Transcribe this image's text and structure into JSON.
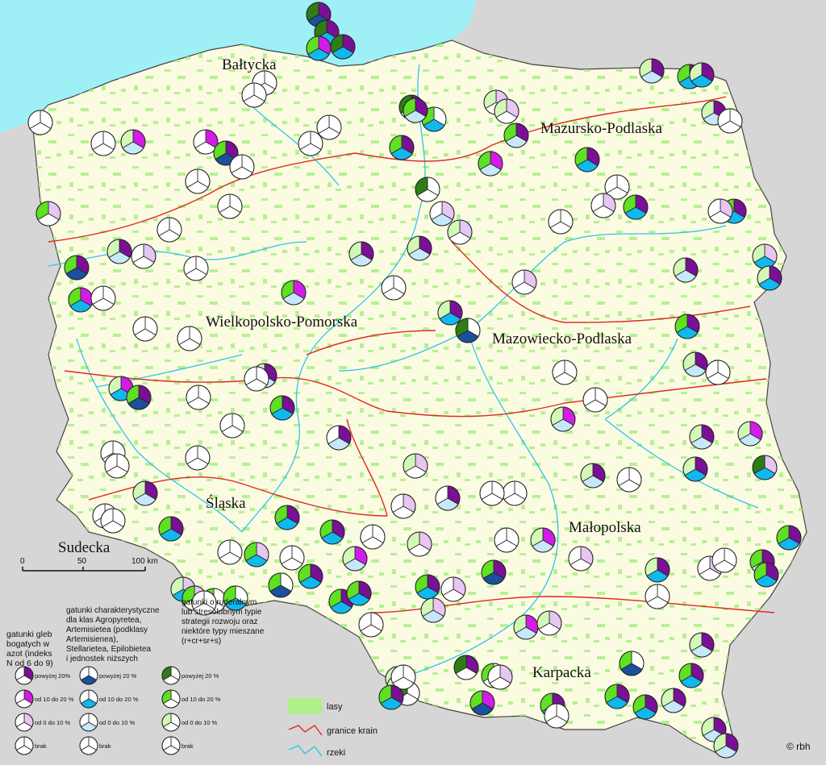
{
  "map": {
    "colors": {
      "sea": "#9ef0f6",
      "land": "#fbfbe2",
      "outside": "#d6d6d6",
      "forest": "#aef08a",
      "border": "#e0291e",
      "river": "#2ec5e8",
      "dark_purple": "#7a1096",
      "magenta": "#d41ce8",
      "lilac": "#e6c6f2",
      "dark_green": "#2e7d16",
      "green": "#5fe022",
      "pale_green": "#d2f8b8",
      "dark_blue": "#1c4f9c",
      "cyan": "#10b8ee",
      "pale_blue": "#c6e8fa"
    },
    "regions": [
      {
        "name": "Bałtycka"
      },
      {
        "name": "Mazursko-Podlaska"
      },
      {
        "name": "Wielkopolsko-Pomorska"
      },
      {
        "name": "Mazowiecko-Podlaska"
      },
      {
        "name": "Śląska"
      },
      {
        "name": "Sudecka"
      },
      {
        "name": "Małopolska"
      },
      {
        "name": "Karpacka"
      }
    ],
    "scale": {
      "labels": [
        "0",
        "50",
        "100 km"
      ]
    },
    "credit": "© rbh"
  },
  "legend": {
    "col1_title": [
      "gatunki gleb",
      "bogatych w",
      "azot (indeks",
      "N od 6 do 9)"
    ],
    "col2_title": [
      "gatunki charakterystyczne",
      "dla klas Agropyretea,",
      "Artemisietea (podklasy",
      "Artemisienea),",
      "Stellarietea, Epilobietea",
      "i jednostek niższych"
    ],
    "col3_title": [
      "gatunki o ruderalnym",
      "lub stresolubnym typie",
      "strategii rozwoju oraz",
      "niektóre typy mieszane",
      "(r+cr+sr+s)"
    ],
    "col1_labels": [
      "powyżej 20%",
      "od 10 do 20 %",
      "od 0 do 10 %",
      "brak"
    ],
    "col2_labels": [
      "powyżej 20 %",
      "od 10 do 20 %",
      "od 0 do 10 %",
      "brak"
    ],
    "col3_labels": [
      "powyżej 20 %",
      "od 10 do 20 %",
      "od 0 do 10 %",
      "brak"
    ],
    "items": [
      {
        "label": "lasy"
      },
      {
        "label": "granice krain"
      },
      {
        "label": "rzeki"
      }
    ]
  },
  "pies": [
    [
      50,
      152,
      0,
      0,
      0
    ],
    [
      395,
      18,
      3,
      3,
      3
    ],
    [
      405,
      40,
      3,
      2,
      3
    ],
    [
      425,
      58,
      3,
      2,
      3
    ],
    [
      395,
      60,
      2,
      2,
      2
    ],
    [
      328,
      103,
      0,
      0,
      0
    ],
    [
      315,
      118,
      0,
      0,
      0
    ],
    [
      165,
      176,
      2,
      1,
      1
    ],
    [
      255,
      176,
      2,
      0,
      0
    ],
    [
      280,
      190,
      3,
      3,
      2
    ],
    [
      300,
      207,
      0,
      0,
      0
    ],
    [
      245,
      225,
      0,
      0,
      0
    ],
    [
      285,
      256,
      0,
      0,
      0
    ],
    [
      385,
      178,
      0,
      0,
      0
    ],
    [
      408,
      158,
      0,
      0,
      0
    ],
    [
      128,
      178,
      0,
      0,
      0
    ],
    [
      60,
      265,
      1,
      0,
      2
    ],
    [
      210,
      285,
      0,
      0,
      0
    ],
    [
      148,
      312,
      3,
      1,
      1
    ],
    [
      178,
      318,
      1,
      0,
      0
    ],
    [
      95,
      332,
      3,
      3,
      2
    ],
    [
      100,
      372,
      2,
      2,
      2
    ],
    [
      128,
      370,
      0,
      0,
      0
    ],
    [
      243,
      333,
      0,
      0,
      0
    ],
    [
      180,
      408,
      0,
      0,
      0
    ],
    [
      235,
      420,
      0,
      0,
      0
    ],
    [
      364,
      363,
      2,
      1,
      2
    ],
    [
      488,
      357,
      0,
      0,
      0
    ],
    [
      448,
      315,
      3,
      1,
      1
    ],
    [
      520,
      308,
      3,
      1,
      1
    ],
    [
      570,
      288,
      1,
      0,
      1
    ],
    [
      548,
      265,
      1,
      1,
      0
    ],
    [
      530,
      235,
      0,
      0,
      3
    ],
    [
      498,
      183,
      3,
      2,
      2
    ],
    [
      510,
      133,
      3,
      1,
      3
    ],
    [
      538,
      148,
      0,
      2,
      2
    ],
    [
      515,
      137,
      3,
      1,
      2
    ],
    [
      615,
      127,
      1,
      0,
      1
    ],
    [
      628,
      138,
      1,
      0,
      1
    ],
    [
      640,
      168,
      3,
      1,
      2
    ],
    [
      608,
      203,
      2,
      1,
      2
    ],
    [
      728,
      198,
      3,
      2,
      2
    ],
    [
      765,
      232,
      0,
      0,
      0
    ],
    [
      748,
      255,
      1,
      0,
      0
    ],
    [
      788,
      257,
      3,
      2,
      2
    ],
    [
      695,
      275,
      0,
      0,
      0
    ],
    [
      650,
      350,
      1,
      0,
      0
    ],
    [
      558,
      388,
      3,
      2,
      1
    ],
    [
      580,
      410,
      0,
      3,
      3
    ],
    [
      808,
      88,
      3,
      1,
      1
    ],
    [
      855,
      95,
      3,
      2,
      2
    ],
    [
      870,
      93,
      3,
      2,
      1
    ],
    [
      885,
      140,
      3,
      1,
      1
    ],
    [
      905,
      150,
      0,
      0,
      0
    ],
    [
      910,
      262,
      3,
      2,
      2
    ],
    [
      893,
      262,
      1,
      0,
      0
    ],
    [
      948,
      318,
      1,
      2,
      1
    ],
    [
      954,
      345,
      3,
      2,
      1
    ],
    [
      850,
      335,
      3,
      1,
      1
    ],
    [
      852,
      405,
      3,
      2,
      2
    ],
    [
      862,
      452,
      3,
      1,
      1
    ],
    [
      890,
      462,
      0,
      0,
      0
    ],
    [
      700,
      462,
      0,
      0,
      0
    ],
    [
      738,
      496,
      0,
      0,
      0
    ],
    [
      698,
      520,
      2,
      1,
      1
    ],
    [
      870,
      542,
      3,
      1,
      1
    ],
    [
      930,
      538,
      2,
      1,
      1
    ],
    [
      862,
      582,
      3,
      2,
      1
    ],
    [
      948,
      580,
      1,
      2,
      3
    ],
    [
      735,
      590,
      3,
      1,
      1
    ],
    [
      780,
      595,
      0,
      0,
      0
    ],
    [
      638,
      612,
      0,
      0,
      0
    ],
    [
      610,
      612,
      0,
      0,
      0
    ],
    [
      555,
      618,
      3,
      1,
      0
    ],
    [
      500,
      628,
      1,
      0,
      0
    ],
    [
      515,
      578,
      1,
      0,
      1
    ],
    [
      420,
      543,
      3,
      1,
      0
    ],
    [
      350,
      506,
      3,
      2,
      2
    ],
    [
      328,
      466,
      3,
      1,
      1
    ],
    [
      318,
      470,
      0,
      0,
      0
    ],
    [
      288,
      528,
      0,
      0,
      0
    ],
    [
      246,
      493,
      0,
      0,
      0
    ],
    [
      245,
      568,
      0,
      0,
      0
    ],
    [
      150,
      482,
      2,
      2,
      1
    ],
    [
      172,
      493,
      3,
      3,
      2
    ],
    [
      140,
      562,
      0,
      0,
      0
    ],
    [
      145,
      578,
      0,
      0,
      0
    ],
    [
      180,
      612,
      3,
      1,
      1
    ],
    [
      130,
      640,
      0,
      0,
      0
    ],
    [
      140,
      646,
      0,
      0,
      0
    ],
    [
      212,
      656,
      3,
      2,
      2
    ],
    [
      285,
      685,
      0,
      0,
      0
    ],
    [
      318,
      688,
      1,
      2,
      2
    ],
    [
      356,
      642,
      3,
      2,
      2
    ],
    [
      362,
      692,
      0,
      0,
      0
    ],
    [
      412,
      660,
      3,
      2,
      2
    ],
    [
      462,
      666,
      0,
      0,
      0
    ],
    [
      520,
      675,
      1,
      0,
      1
    ],
    [
      440,
      693,
      2,
      1,
      1
    ],
    [
      385,
      715,
      3,
      2,
      2
    ],
    [
      348,
      726,
      0,
      3,
      2
    ],
    [
      423,
      746,
      3,
      2,
      2
    ],
    [
      445,
      736,
      3,
      2,
      2
    ],
    [
      460,
      775,
      0,
      0,
      0
    ],
    [
      530,
      728,
      3,
      2,
      2
    ],
    [
      537,
      757,
      1,
      1,
      1
    ],
    [
      562,
      731,
      1,
      0,
      0
    ],
    [
      628,
      670,
      0,
      0,
      0
    ],
    [
      673,
      670,
      2,
      1,
      1
    ],
    [
      720,
      693,
      1,
      0,
      0
    ],
    [
      612,
      710,
      3,
      3,
      2
    ],
    [
      815,
      707,
      3,
      2,
      1
    ],
    [
      815,
      740,
      0,
      0,
      0
    ],
    [
      880,
      705,
      1,
      0,
      0
    ],
    [
      898,
      695,
      0,
      0,
      0
    ],
    [
      945,
      697,
      3,
      1,
      2
    ],
    [
      950,
      713,
      3,
      2,
      2
    ],
    [
      978,
      667,
      3,
      2,
      2
    ],
    [
      870,
      800,
      3,
      1,
      1
    ],
    [
      857,
      838,
      3,
      2,
      2
    ],
    [
      783,
      823,
      0,
      3,
      2
    ],
    [
      765,
      864,
      3,
      2,
      2
    ],
    [
      835,
      869,
      3,
      1,
      1
    ],
    [
      800,
      877,
      3,
      2,
      2
    ],
    [
      685,
      875,
      3,
      2,
      2
    ],
    [
      690,
      888,
      0,
      0,
      0
    ],
    [
      652,
      778,
      2,
      1,
      1
    ],
    [
      681,
      773,
      1,
      0,
      1
    ],
    [
      612,
      838,
      0,
      0,
      2
    ],
    [
      620,
      840,
      1,
      0,
      0
    ],
    [
      578,
      828,
      3,
      0,
      3
    ],
    [
      598,
      872,
      2,
      3,
      2
    ],
    [
      493,
      842,
      1,
      0,
      1
    ],
    [
      495,
      852,
      3,
      1,
      1
    ],
    [
      505,
      860,
      0,
      0,
      3
    ],
    [
      500,
      840,
      0,
      0,
      0
    ],
    [
      485,
      865,
      3,
      2,
      2
    ],
    [
      227,
      731,
      1,
      2,
      1
    ],
    [
      241,
      742,
      1,
      0,
      2
    ],
    [
      265,
      745,
      0,
      0,
      2
    ],
    [
      292,
      742,
      0,
      2,
      2
    ],
    [
      253,
      748,
      0,
      0,
      0
    ],
    [
      885,
      905,
      3,
      1,
      1
    ],
    [
      900,
      925,
      3,
      1,
      1
    ]
  ]
}
